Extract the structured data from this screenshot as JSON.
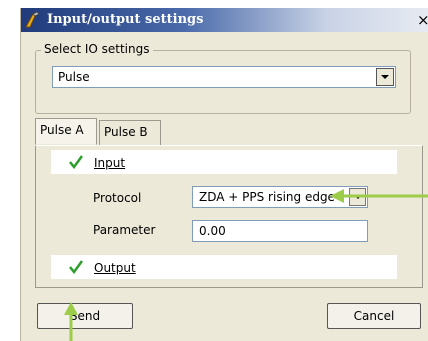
{
  "window": {
    "title": "Input/output settings",
    "close": "×"
  },
  "io_group": {
    "legend": "Select IO settings",
    "selected": "Pulse"
  },
  "tabs": [
    {
      "label": "Pulse A",
      "active": true
    },
    {
      "label": "Pulse B",
      "active": false
    }
  ],
  "input_section": {
    "label": "Input",
    "protocol_label": "Protocol",
    "protocol_value": "ZDA + PPS rising edge",
    "parameter_label": "Parameter",
    "parameter_value": "0.00"
  },
  "output_section": {
    "label": "Output"
  },
  "buttons": {
    "send": "Send",
    "cancel": "Cancel"
  },
  "colors": {
    "check": "#2e9e2e",
    "arrow": "#9ccc4a",
    "titlebar": "#203a7a"
  }
}
